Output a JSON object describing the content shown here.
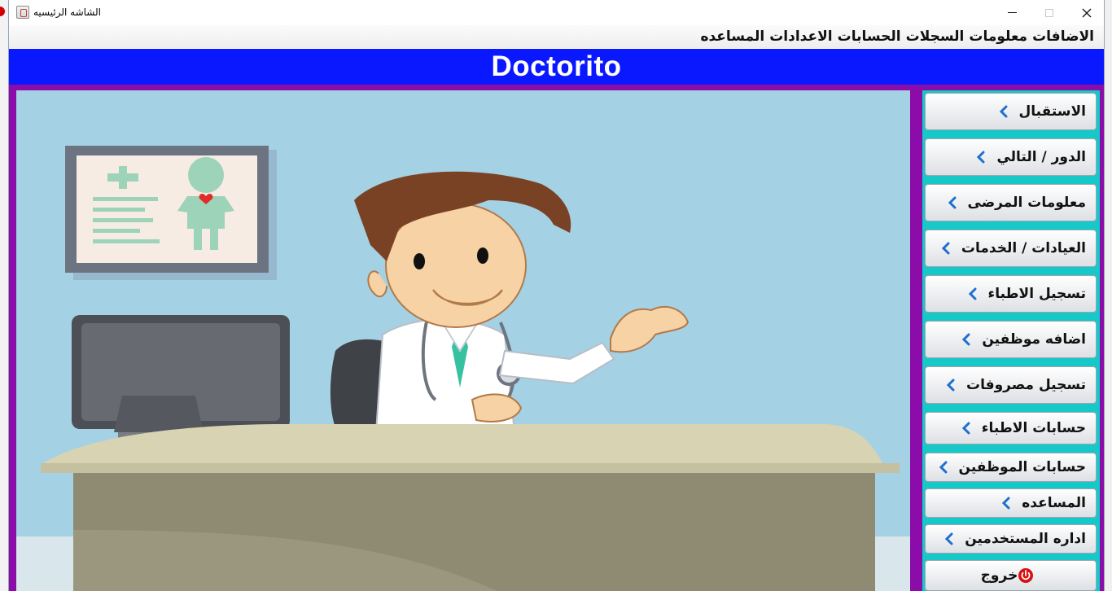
{
  "window": {
    "title": "الشاشه الرئيسيه"
  },
  "menubar": {
    "items": [
      "الاضافات",
      "معلومات",
      "السجلات",
      "الحسابات",
      "الاعدادات",
      "المساعده"
    ]
  },
  "header": {
    "brand": "Doctorito",
    "color": "#0a18ff"
  },
  "sidebar": {
    "buttons": [
      {
        "label": "الاستقبال",
        "icon": "chevron-left-icon"
      },
      {
        "label": "الدور / التالي",
        "icon": "chevron-left-icon"
      },
      {
        "label": "معلومات المرضى",
        "icon": "chevron-left-icon"
      },
      {
        "label": "العيادات / الخدمات",
        "icon": "chevron-left-icon"
      },
      {
        "label": "تسجيل الاطباء",
        "icon": "chevron-left-icon"
      },
      {
        "label": "اضافه موظفين",
        "icon": "chevron-left-icon"
      },
      {
        "label": "تسجيل مصروفات",
        "icon": "chevron-left-icon"
      },
      {
        "label": "حسابات الاطباء",
        "icon": "chevron-left-icon"
      },
      {
        "label": "حسابات الموظفين",
        "icon": "chevron-left-icon"
      },
      {
        "label": "المساعده",
        "icon": "chevron-left-icon"
      },
      {
        "label": "اداره المستخدمين",
        "icon": "chevron-left-icon"
      }
    ],
    "exit": {
      "label": "خروج",
      "icon": "power-icon"
    }
  },
  "colors": {
    "frame": "#8b0ca8",
    "sidebar_bg": "#16c8c8",
    "picture_bg": "#a4d1e4"
  }
}
